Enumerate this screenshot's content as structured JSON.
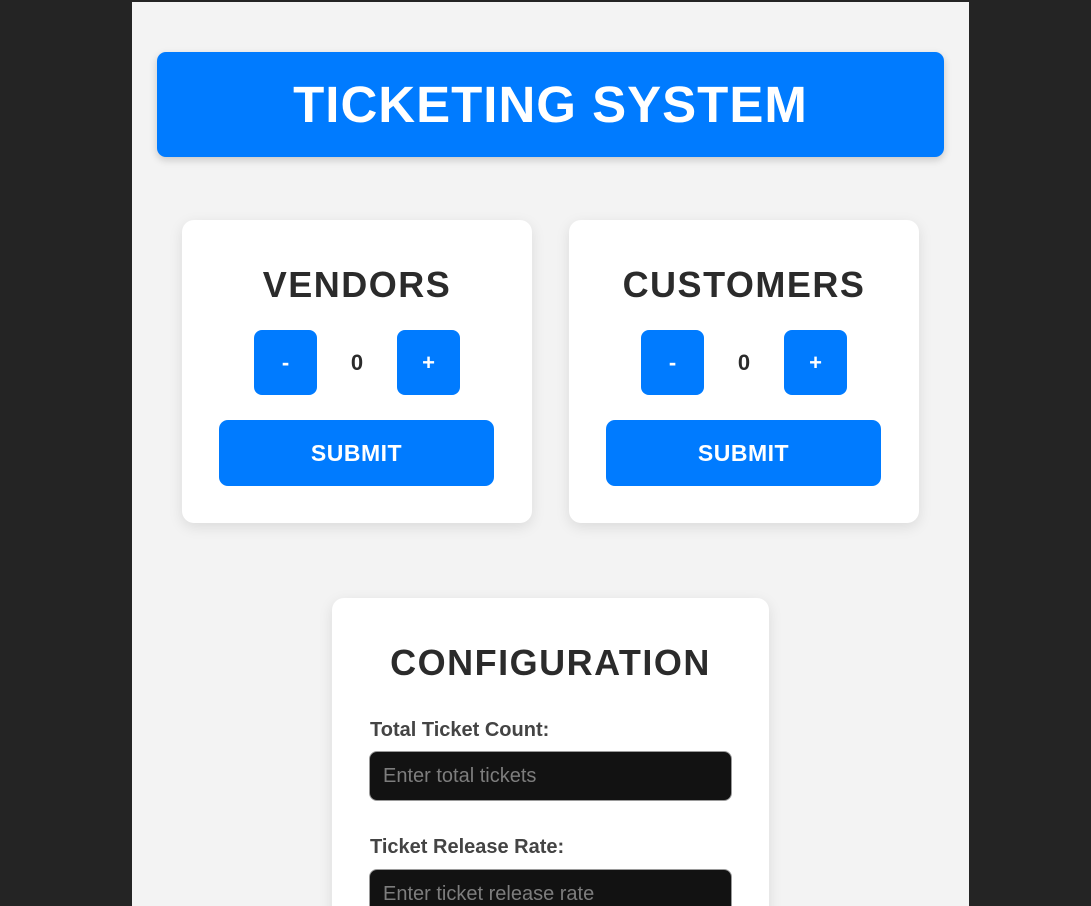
{
  "header": {
    "title": "TICKETING SYSTEM"
  },
  "vendors": {
    "title": "VENDORS",
    "decrement_label": "-",
    "count": "0",
    "increment_label": "+",
    "submit_label": "SUBMIT"
  },
  "customers": {
    "title": "CUSTOMERS",
    "decrement_label": "-",
    "count": "0",
    "increment_label": "+",
    "submit_label": "SUBMIT"
  },
  "configuration": {
    "title": "CONFIGURATION",
    "fields": [
      {
        "label": "Total Ticket Count:",
        "value": "",
        "placeholder": "Enter total tickets"
      },
      {
        "label": "Ticket Release Rate:",
        "value": "",
        "placeholder": "Enter ticket release rate"
      }
    ]
  },
  "colors": {
    "accent": "#007bff",
    "page_background": "#f3f3f3",
    "outer_background": "#242424",
    "card_background": "#ffffff",
    "input_background": "#121212"
  }
}
